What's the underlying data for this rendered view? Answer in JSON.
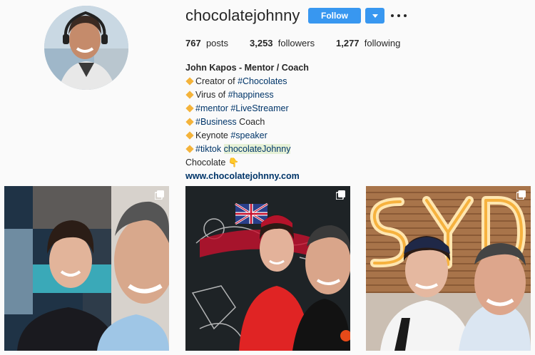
{
  "profile": {
    "username": "chocolatejohnny",
    "follow_label": "Follow",
    "dropdown_icon": "chevron-down-icon",
    "more_icon": "more-options-icon",
    "accent_color": "#3897f0"
  },
  "stats": {
    "posts_count": "767",
    "posts_label": "posts",
    "followers_count": "3,253",
    "followers_label": "followers",
    "following_count": "1,277",
    "following_label": "following"
  },
  "bio": {
    "full_name": "John Kapos - Mentor / Coach",
    "line1_text": "Creator of ",
    "line1_tag": "#Chocolates",
    "line2_text": "Virus of ",
    "line2_tag": "#happiness",
    "line3_tag1": "#mentor",
    "line3_tag2": "#LiveStreamer",
    "line4_tag": "#Business",
    "line4_text": " Coach",
    "line5_text": "Keynote ",
    "line5_tag": "#speaker",
    "line6_tag": "#tiktok",
    "line6_mention": "chocolateJohnny",
    "line7_text": "Chocolate 👇",
    "website": "www.chocolatejohnny.com"
  },
  "posts": [
    {
      "icon": "multiple-photos-icon"
    },
    {
      "icon": "multiple-photos-icon"
    },
    {
      "icon": "multiple-photos-icon",
      "sign_text": "SYD"
    }
  ]
}
